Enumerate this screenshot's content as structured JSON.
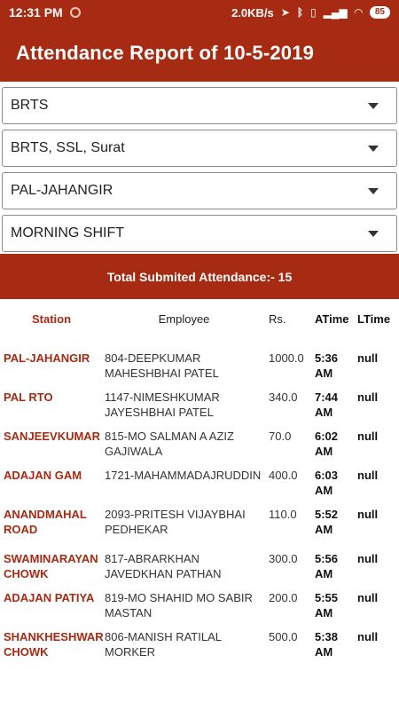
{
  "status_bar": {
    "time": "12:31 PM",
    "speed": "2.0KB/s",
    "battery": "85",
    "icons": [
      "location-icon",
      "bluetooth-icon",
      "vibrate-icon",
      "signal-icon",
      "wifi-icon"
    ]
  },
  "app_bar": {
    "title": "Attendance Report of 10-5-2019"
  },
  "selectors": [
    {
      "value": "BRTS"
    },
    {
      "value": "BRTS, SSL, Surat"
    },
    {
      "value": "PAL-JAHANGIR"
    },
    {
      "value": "MORNING SHIFT"
    }
  ],
  "summary": {
    "text": "Total Submited Attendance:- 15"
  },
  "table": {
    "headers": {
      "station": "Station",
      "employee": "Employee",
      "rs": "Rs.",
      "atime": "ATime",
      "ltime": "LTime"
    },
    "rows": [
      {
        "station": "PAL-JAHANGIR",
        "employee": "804-DEEPKUMAR MAHESHBHAI PATEL",
        "rs": "1000.0",
        "atime": "5:36 AM",
        "ltime": "null"
      },
      {
        "station": "PAL RTO",
        "employee": "1147-NIMESHKUMAR JAYESHBHAI PATEL",
        "rs": "340.0",
        "atime": "7:44 AM",
        "ltime": "null"
      },
      {
        "station": "SANJEEVKUMAR",
        "employee": "815-MO SALMAN A AZIZ GAJIWALA",
        "rs": "70.0",
        "atime": "6:02 AM",
        "ltime": "null"
      },
      {
        "station": "ADAJAN GAM",
        "employee": "1721-MAHAMMADAJRUDDIN",
        "rs": "400.0",
        "atime": "6:03 AM",
        "ltime": "null"
      },
      {
        "station": "ANANDMAHAL ROAD",
        "employee": "2093-PRITESH VIJAYBHAI PEDHEKAR",
        "rs": "110.0",
        "atime": "5:52 AM",
        "ltime": "null"
      },
      {
        "station": "SWAMINARAYAN CHOWK",
        "employee": "817-ABRARKHAN JAVEDKHAN PATHAN",
        "rs": "300.0",
        "atime": "5:56 AM",
        "ltime": "null"
      },
      {
        "station": "ADAJAN PATIYA",
        "employee": "819-MO SHAHID MO SABIR MASTAN",
        "rs": "200.0",
        "atime": "5:55 AM",
        "ltime": "null"
      },
      {
        "station": "SHANKHESHWAR CHOWK",
        "employee": "806-MANISH RATILAL MORKER",
        "rs": "500.0",
        "atime": "5:38 AM",
        "ltime": "null"
      }
    ]
  }
}
